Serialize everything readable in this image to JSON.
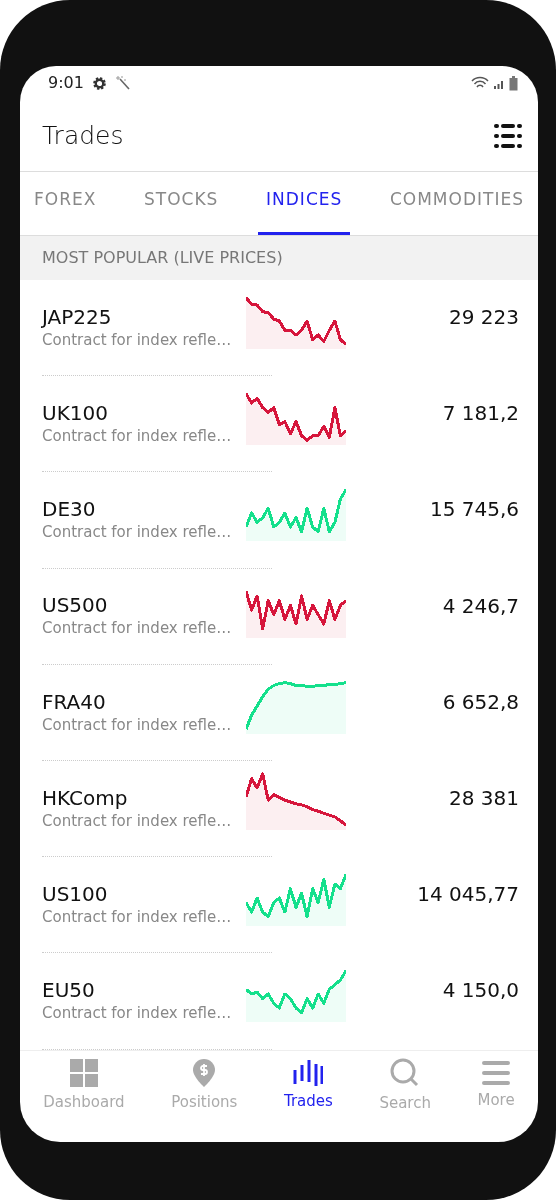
{
  "status_bar": {
    "time": "9:01"
  },
  "header": {
    "title": "Trades"
  },
  "tabs": [
    {
      "label": "FOREX",
      "selected": false
    },
    {
      "label": "STOCKS",
      "selected": false
    },
    {
      "label": "INDICES",
      "selected": true
    },
    {
      "label": "COMMODITIES",
      "selected": false
    }
  ],
  "section": {
    "title": "MOST POPULAR (LIVE PRICES)"
  },
  "instruments": [
    {
      "name": "JAP225",
      "description": "Contract for index refle…",
      "price": "29 223",
      "color": "#d6163c"
    },
    {
      "name": "UK100",
      "description": "Contract for index refle…",
      "price": "7 181,2",
      "color": "#d6163c"
    },
    {
      "name": "DE30",
      "description": "Contract for index refle…",
      "price": "15 745,6",
      "color": "#14e08c"
    },
    {
      "name": "US500",
      "description": "Contract for index refle…",
      "price": "4 246,7",
      "color": "#d6163c"
    },
    {
      "name": "FRA40",
      "description": "Contract for index refle…",
      "price": "6 652,8",
      "color": "#14e08c"
    },
    {
      "name": "HKComp",
      "description": "Contract for index refle…",
      "price": "28 381",
      "color": "#d6163c"
    },
    {
      "name": "US100",
      "description": "Contract for index refle…",
      "price": "14 045,77",
      "color": "#14e08c"
    },
    {
      "name": "EU50",
      "description": "Contract for index refle…",
      "price": "4 150,0",
      "color": "#14e08c"
    }
  ],
  "bottom_nav": [
    {
      "kind": "dashboard",
      "label": "Dashboard",
      "selected": false
    },
    {
      "kind": "positions",
      "label": "Positions",
      "selected": false
    },
    {
      "kind": "trades",
      "label": "Trades",
      "selected": true
    },
    {
      "kind": "search",
      "label": "Search",
      "selected": false
    },
    {
      "kind": "more",
      "label": "More",
      "selected": false
    }
  ]
}
